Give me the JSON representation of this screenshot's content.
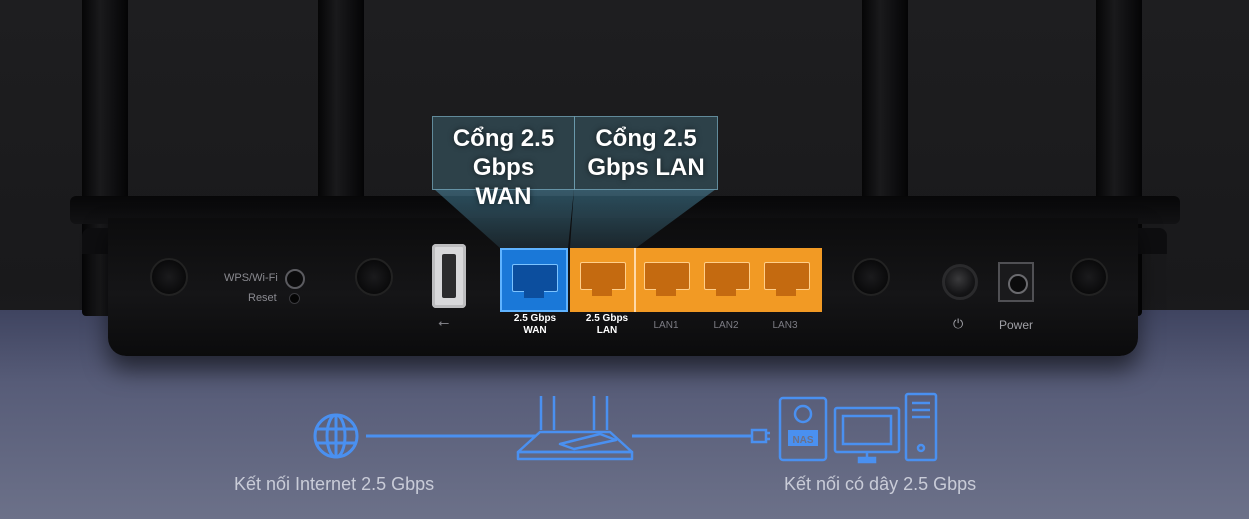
{
  "callouts": {
    "wan": "Cổng 2.5 Gbps WAN",
    "wan_lines": [
      "Cổng 2.5",
      "Gbps",
      "WAN"
    ],
    "lan_lines": [
      "Cổng 2.5",
      "Gbps LAN"
    ]
  },
  "device": {
    "wps_label": "WPS/Wi-Fi",
    "reset_label": "Reset",
    "usb_symbol": "⭠",
    "ports": [
      {
        "label_line1": "2.5 Gbps",
        "label_line2": "WAN",
        "color": "#1a78d8"
      },
      {
        "label_line1": "2.5 Gbps",
        "label_line2": "LAN",
        "color": "#f29a24"
      },
      {
        "label_line1": "LAN1",
        "label_line2": "",
        "color": "#f29a24"
      },
      {
        "label_line1": "LAN2",
        "label_line2": "",
        "color": "#f29a24"
      },
      {
        "label_line1": "LAN3",
        "label_line2": "",
        "color": "#f29a24"
      }
    ],
    "power_symbol": "⏻",
    "power_label": "Power"
  },
  "diagram": {
    "internet_caption": "Kết nối Internet 2.5 Gbps",
    "wired_caption": "Kết nối có dây 2.5 Gbps",
    "nas_label": "NAS",
    "icons": [
      "globe-icon",
      "router-icon",
      "ethernet-plug-icon",
      "nas-icon",
      "monitor-icon",
      "pc-tower-icon"
    ],
    "line_color": "#4a90f0"
  }
}
